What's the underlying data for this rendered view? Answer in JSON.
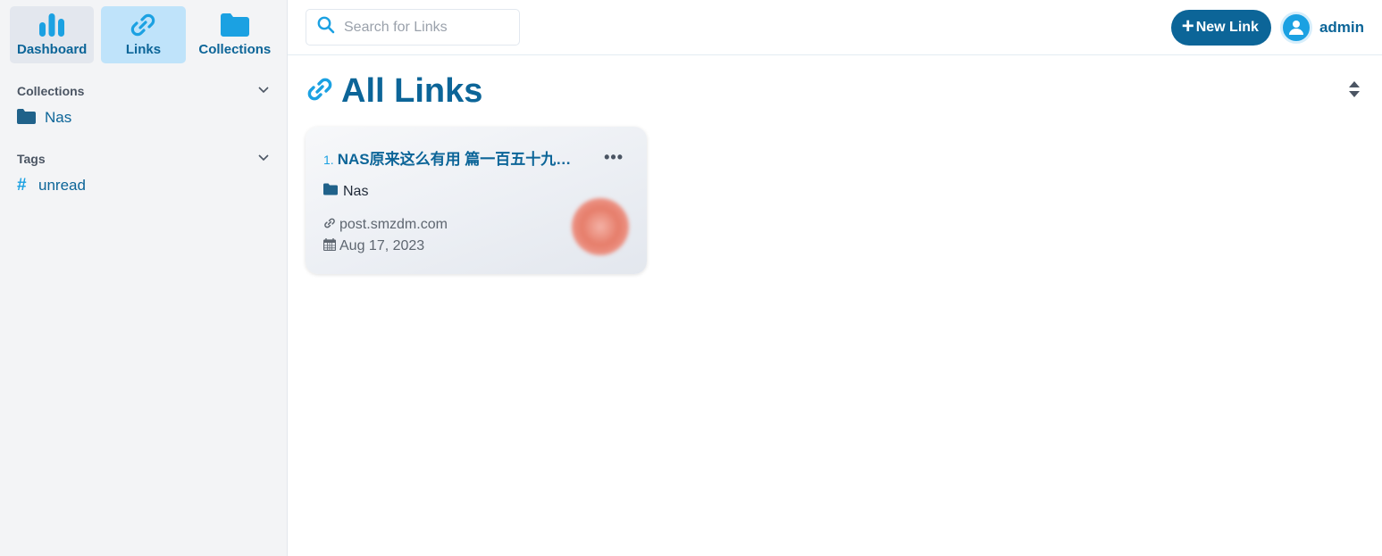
{
  "sidebar": {
    "nav": [
      {
        "label": "Dashboard",
        "icon": "chart-bars-icon"
      },
      {
        "label": "Links",
        "icon": "link-icon"
      },
      {
        "label": "Collections",
        "icon": "folder-icon"
      }
    ],
    "collections_title": "Collections",
    "collections": [
      {
        "label": "Nas",
        "icon": "folder-icon"
      }
    ],
    "tags_title": "Tags",
    "tags": [
      {
        "label": "unread",
        "icon": "hash-icon"
      }
    ]
  },
  "topbar": {
    "search_placeholder": "Search for Links",
    "new_link_label": "New Link",
    "user_name": "admin"
  },
  "page": {
    "title": "All Links"
  },
  "links": [
    {
      "index": "1.",
      "title": "NAS原来这么有用 篇一百五十九…",
      "collection": "Nas",
      "domain": "post.smzdm.com",
      "date": "Aug 17, 2023"
    }
  ],
  "colors": {
    "primary": "#0c6598",
    "accent": "#1ba1e2",
    "sidebar_bg": "#f3f4f6",
    "active_nav_bg": "#bfe3fa"
  }
}
